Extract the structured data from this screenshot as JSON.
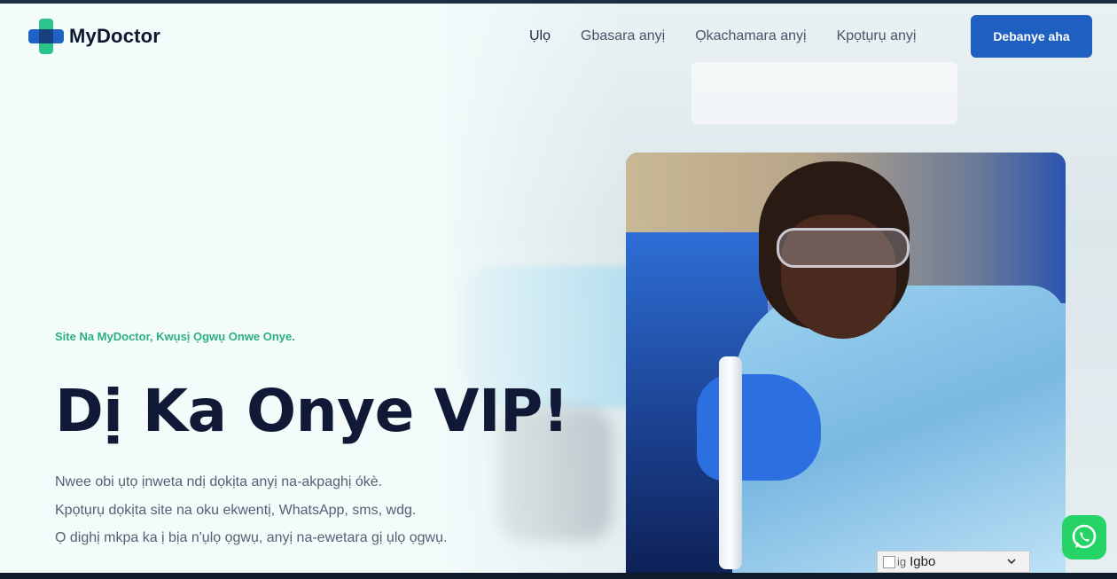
{
  "header": {
    "logo_text": "MyDoctor",
    "nav": [
      {
        "label": "Ụlọ",
        "active": true
      },
      {
        "label": "Gbasara anyị",
        "active": false
      },
      {
        "label": "Ọkachamara anyị",
        "active": false
      },
      {
        "label": "Kpọtụrụ anyị",
        "active": false
      }
    ],
    "cta_label": "Debanye aha"
  },
  "hero": {
    "eyebrow": "Site Na MyDoctor, Kwụsị Ọgwụ Onwe Onye.",
    "headline": "Dị Ka Onye VIP!",
    "paragraphs": [
      "Nwee obi ụtọ ịnweta ndị dọkịta anyị na-akpaghị ókè.",
      "Kpọtụrụ dọkịta site na oku ekwentị, WhatsApp, sms, wdg.",
      "Ọ dighị mkpa ka ị bịa n'ụlọ ọgwụ, anyị na-ewetara gị ụlọ ọgwụ."
    ]
  },
  "language_select": {
    "flag_alt": "ig",
    "value": "Igbo"
  },
  "icons": {
    "whatsapp": "whatsapp-icon",
    "logo": "medical-cross-icon",
    "chevron": "chevron-down-icon"
  },
  "colors": {
    "accent_blue": "#1e5fc1",
    "accent_green": "#2bb07f",
    "heading": "#101935",
    "whatsapp": "#25d366"
  }
}
